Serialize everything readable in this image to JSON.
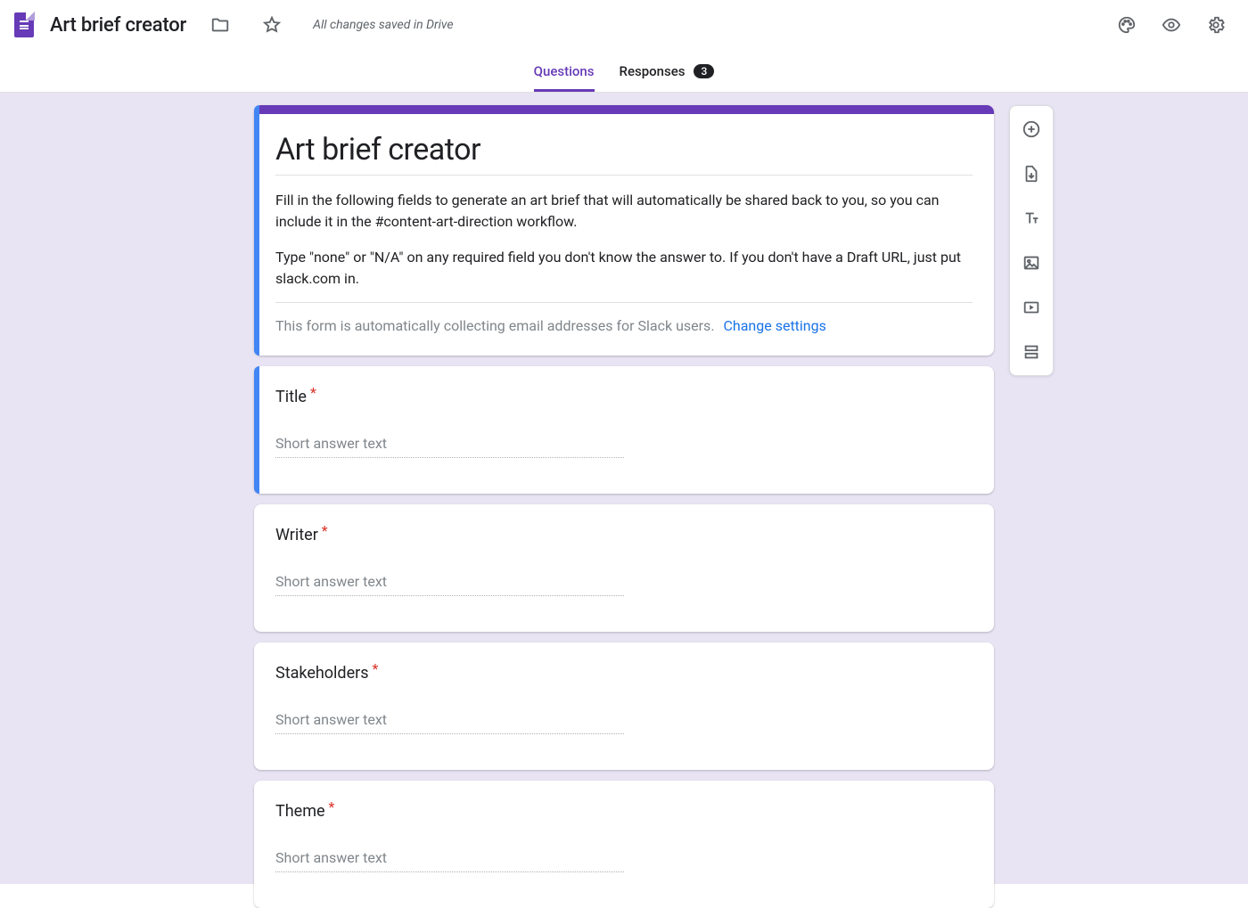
{
  "topbar": {
    "doc_title": "Art brief creator",
    "save_status": "All changes saved in Drive"
  },
  "tabs": {
    "questions": "Questions",
    "responses": "Responses",
    "responses_count": "3"
  },
  "header_card": {
    "title": "Art brief creator",
    "desc_p1": "Fill in the following fields to generate an art brief that will automatically be shared back to you, so you can include it in the #content-art-direction workflow.",
    "desc_p2": "Type \"none\" or \"N/A\" on any required field you don't know the answer to. If you don't have a Draft URL, just put slack.com in.",
    "email_notice": "This form is automatically collecting email addresses for Slack users.",
    "change_settings": "Change settings"
  },
  "questions": [
    {
      "label": "Title",
      "required": true,
      "placeholder": "Short answer text"
    },
    {
      "label": "Writer",
      "required": true,
      "placeholder": "Short answer text"
    },
    {
      "label": "Stakeholders",
      "required": true,
      "placeholder": "Short answer text"
    },
    {
      "label": "Theme",
      "required": true,
      "placeholder": "Short answer text"
    }
  ],
  "required_marker": "*"
}
